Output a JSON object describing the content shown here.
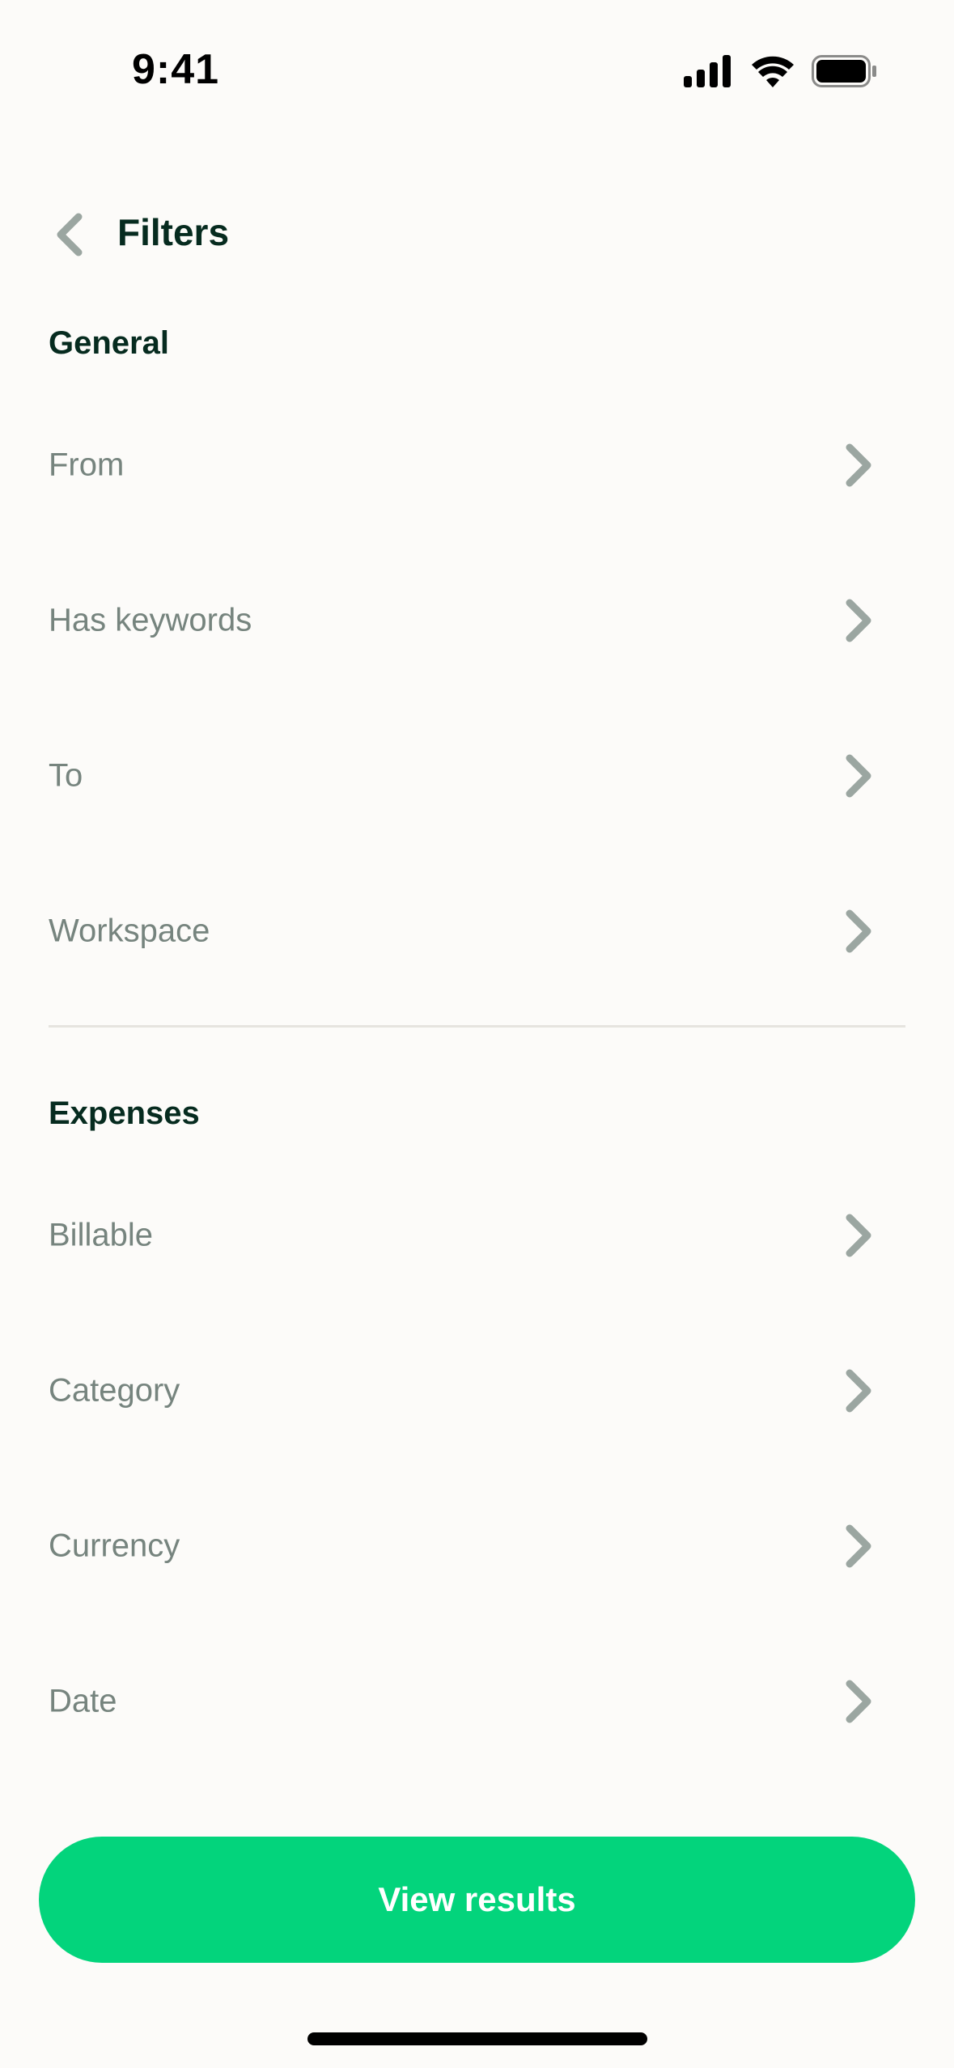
{
  "status_bar": {
    "time": "9:41",
    "icons": [
      "cellular-signal-icon",
      "wifi-icon",
      "battery-icon"
    ]
  },
  "header": {
    "back_icon": "chevron-left-icon",
    "title": "Filters"
  },
  "sections": {
    "general": {
      "title": "General",
      "items": [
        {
          "label": "From"
        },
        {
          "label": "Has keywords"
        },
        {
          "label": "To"
        },
        {
          "label": "Workspace"
        }
      ]
    },
    "expenses": {
      "title": "Expenses",
      "items": [
        {
          "label": "Billable"
        },
        {
          "label": "Category"
        },
        {
          "label": "Currency"
        },
        {
          "label": "Date"
        }
      ]
    }
  },
  "footer": {
    "view_results_label": "View results"
  },
  "colors": {
    "background": "#FCFBF9",
    "heading": "#062B1F",
    "label": "#76847E",
    "chevron": "#9BA6A1",
    "accent": "#03D47C",
    "divider": "#E6E4DF"
  }
}
